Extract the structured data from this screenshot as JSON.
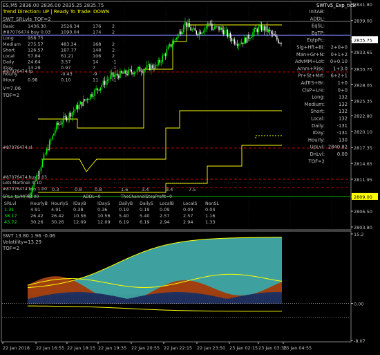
{
  "colors": {
    "background": "#000000",
    "candle_up": "#00ff00",
    "candle_down": "#ffffff",
    "bid_line": "#7f7fff",
    "yellow_line": "#ffff00",
    "red_dashed": "#ff0000",
    "green_text": "#00ff00",
    "axis_text": "#c0c0c0",
    "highlight_green": "#00c000",
    "highlight_yellow": "#ffff00",
    "teal_fill": "#3fa0a0",
    "rust_fill": "#a04010",
    "navy_fill": "#203060"
  },
  "header": {
    "symbol_line": "ES,M5  2836.00 2836.00 2835.25 2835.75",
    "trend_line": "Trend Direction:  UP  |  Ready To Trade:  DOWN",
    "indicator_label": "SWTv5_Exp_tick"
  },
  "left_panel": {
    "title": "SWT_SRLvls_TOF=2",
    "rows": [
      {
        "name": "Basic",
        "c1": "1436.30",
        "c2": "2526.34",
        "c3": "176",
        "c4": "2"
      },
      {
        "name": "#87076474 buy 0.03",
        "c1": "",
        "c2": "1090.04",
        "c3": "174",
        "c4": "2"
      },
      {
        "name": "Long",
        "c1": "958.75",
        "c2": "",
        "c3": "",
        "c4": ""
      },
      {
        "name": "Medium",
        "c1": "275.57",
        "c2": "483.34",
        "c3": "168",
        "c4": "2"
      },
      {
        "name": "Short",
        "c1": "126.57",
        "c2": "187.77",
        "c3": "148",
        "c4": "2"
      },
      {
        "name": "Local",
        "c1": "57.84",
        "c2": "61.21",
        "c3": "106",
        "c4": "2"
      },
      {
        "name": "Daily",
        "c1": "24.64",
        "c2": "3.57",
        "c3": "14",
        "c4": "-1"
      },
      {
        "name": "IDay",
        "c1": "13.29",
        "c2": "0.97",
        "c3": "7",
        "c4": "-1"
      },
      {
        "name": "Hourly",
        "c1": "",
        "c2": "-0.43",
        "c3": "-9",
        "c4": "1"
      },
      {
        "name": "IHour",
        "c1": "0.98",
        "c2": "0.10",
        "c3": "11",
        "c4": "-1"
      }
    ],
    "v_line": "V=7.06",
    "tof_line": "TOF=2",
    "order_label_mid": "#87076474 sl",
    "order_label_upper": "#87076474 tp",
    "order_label_upper2": "#87076474"
  },
  "lower_labels": {
    "line1": "#87076474 buy 0.03",
    "line2": "#87076474 buy 1.00",
    "line3": "Lots Martinal: 0.10",
    "line4": "SRLs_tp/M(%3.00",
    "scale_marks": [
      "0.3",
      "0.8",
      "0.8",
      "1.6",
      "3.4",
      "3.4",
      "7.5"
    ],
    "addl_label": "ADDL=0",
    "channel_label": "TheChannelStopProfit=0"
  },
  "bottom_table": {
    "headers": [
      "SRLvl",
      "HourlyB",
      "HourlyS",
      "IDayB",
      "IDayS",
      "DailyB",
      "DailyS",
      "LocalB",
      "LocalS",
      "NonSL"
    ],
    "rows": [
      [
        "1.31",
        "4.91",
        "4.91",
        "0.38",
        "0.36",
        "0.19",
        "0.19",
        "0.09",
        "0.09",
        "0.04"
      ],
      [
        "38.17",
        "26.42",
        "26.42",
        "10.56",
        "10.56",
        "5.40",
        "5.40",
        "2.57",
        "2.57",
        "1.16"
      ],
      [
        "43.72",
        "30.26",
        "30.26",
        "12.09",
        "12.09",
        "6.19",
        "6.19",
        "2.94",
        "2.94",
        "1.33"
      ]
    ]
  },
  "right_panel": {
    "rows": [
      {
        "label": "InitAB:",
        "value": ""
      },
      {
        "label": "ADDL:",
        "value": ""
      },
      {
        "label": "EqSL:",
        "value": ""
      },
      {
        "label": "EqTP:",
        "value": ""
      },
      {
        "label": "EqtpPc:",
        "value": ""
      },
      {
        "label": "Sig+Hft+Bi:",
        "value": "2+0+0"
      },
      {
        "label": "Man+Gr+N:",
        "value": "0+1+2"
      },
      {
        "label": "AdvMM+Lot:",
        "value": "0+0.10"
      },
      {
        "label": "Amm+Risk:",
        "value": "1+3.0"
      },
      {
        "label": "Pr+St+Mrt:",
        "value": "6+2+1"
      },
      {
        "label": "AdTrS+Br:",
        "value": "1+0"
      },
      {
        "label": "ClsP+Lre:",
        "value": "0+0"
      },
      {
        "label": "Long:",
        "value": "132"
      },
      {
        "label": "Medium:",
        "value": "132"
      },
      {
        "label": "Short:",
        "value": "132"
      },
      {
        "label": "Local:",
        "value": "132"
      },
      {
        "label": "Daily:",
        "value": "-131"
      },
      {
        "label": "IDay:",
        "value": "-131"
      },
      {
        "label": "Hourly:",
        "value": "130"
      },
      {
        "label": "UpLvl:",
        "value": "2840.82"
      },
      {
        "label": "DnLvl:",
        "value": "0.00"
      },
      {
        "label": "TOF=2",
        "value": ""
      }
    ]
  },
  "price_axis": {
    "labels": [
      "2841.80",
      "2839.00",
      "2835.75",
      "2833.65",
      "2830.75",
      "2828.05",
      "2825.35",
      "2822.80",
      "2820.10",
      "2817.35",
      "2814.65",
      "2811.95",
      "2809.00",
      "2806.50",
      "2803.80"
    ],
    "current_price": "2835.75",
    "highlight_price": "2809.00"
  },
  "sub_window": {
    "title": "SWT 13.80 1.96 -0.06",
    "line2": "Volatility=13.29",
    "line3": "TOF=2",
    "axis_labels": [
      "15.2",
      "0.00",
      "-8.07"
    ]
  },
  "time_axis": {
    "labels": [
      "22 Jan 2018",
      "22 Jan 16:55",
      "22 Jan 18:15",
      "22 Jan 19:35",
      "22 Jan 20:55",
      "22 Jan 22:15",
      "22 Jan 23:50",
      "23 Jan 02:15",
      "23 Jan 03:35",
      "23 Jan 04:55"
    ]
  }
}
